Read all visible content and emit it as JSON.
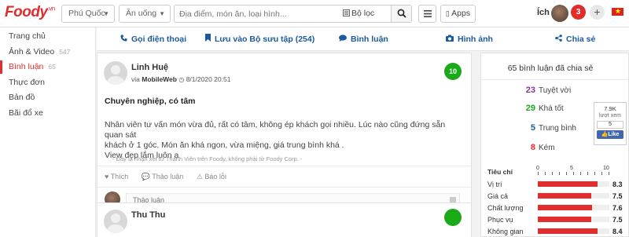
{
  "header": {
    "logo_text": "Foody",
    "logo_suffix": ".vn",
    "location": "Phú Quốc",
    "category": "Ăn uống",
    "search_placeholder": "Địa điểm, món ăn, loại hình...",
    "filter_label": "Bộ lọc",
    "apps_label": "Apps",
    "user_name": "Ích",
    "notification_count": "3"
  },
  "sidebar": {
    "items": [
      {
        "label": "Trang chủ",
        "count": ""
      },
      {
        "label": "Ảnh & Video",
        "count": "547"
      },
      {
        "label": "Bình luận",
        "count": "65"
      },
      {
        "label": "Thực đơn",
        "count": ""
      },
      {
        "label": "Bản đồ",
        "count": ""
      },
      {
        "label": "Bãi đổ xe",
        "count": ""
      }
    ]
  },
  "actions": {
    "call": "Gọi điện thoại",
    "save": "Lưu vào Bộ sưu tập (254)",
    "comment": "Bình luận",
    "photo": "Hình ảnh",
    "share": "Chia sẻ"
  },
  "review": {
    "name": "Linh Huệ",
    "via": "via",
    "device": "MobileWeb",
    "date": "8/1/2020 20:51",
    "score": "10",
    "title": "Chuyên nghiệp, có tâm",
    "body_line1": "Nhân viên tư vấn món vừa đủ, rất có tâm, không ép khách gọi nhiều. Lúc nào cũng đứng sẵn quan sát",
    "body_line2": "khách ở 1 góc. Món ăn khá ngon, vừa miệng, giá trung bình khá .",
    "body_line3": "View đẹp lắm luôn ạ",
    "note": "- Đây là nhận xét từ Thành Viên trên Foody, không phải từ Foody Corp. -",
    "like": "Thích",
    "discuss": "Thảo luận",
    "report": "Báo lỗi",
    "comment_placeholder": "Thảo luận"
  },
  "review2": {
    "name": "Thu Thu"
  },
  "summary": {
    "title": "65 bình luận đã chia sẻ",
    "rows": [
      {
        "num": "23",
        "label": "Tuyệt vời",
        "color": "#8e2f9e"
      },
      {
        "num": "29",
        "label": "Khá tốt",
        "color": "#1aaa19"
      },
      {
        "num": "5",
        "label": "Trung bình",
        "color": "#1a5a9e"
      },
      {
        "num": "8",
        "label": "Kém",
        "color": "#e12d2d"
      }
    ],
    "fb_views": "7.9K",
    "fb_views_label": "lượt xem",
    "fb_count": "5",
    "fb_like": "Like"
  },
  "criteria": {
    "header": "Tiêu chí",
    "ticks": [
      "0",
      "5",
      "10"
    ],
    "max": 10,
    "items": [
      {
        "label": "Vị trí",
        "value": 8.3
      },
      {
        "label": "Giá cả",
        "value": 7.5
      },
      {
        "label": "Chất lượng",
        "value": 7.6
      },
      {
        "label": "Phục vụ",
        "value": 7.5
      },
      {
        "label": "Không gian",
        "value": 8.4
      }
    ]
  }
}
